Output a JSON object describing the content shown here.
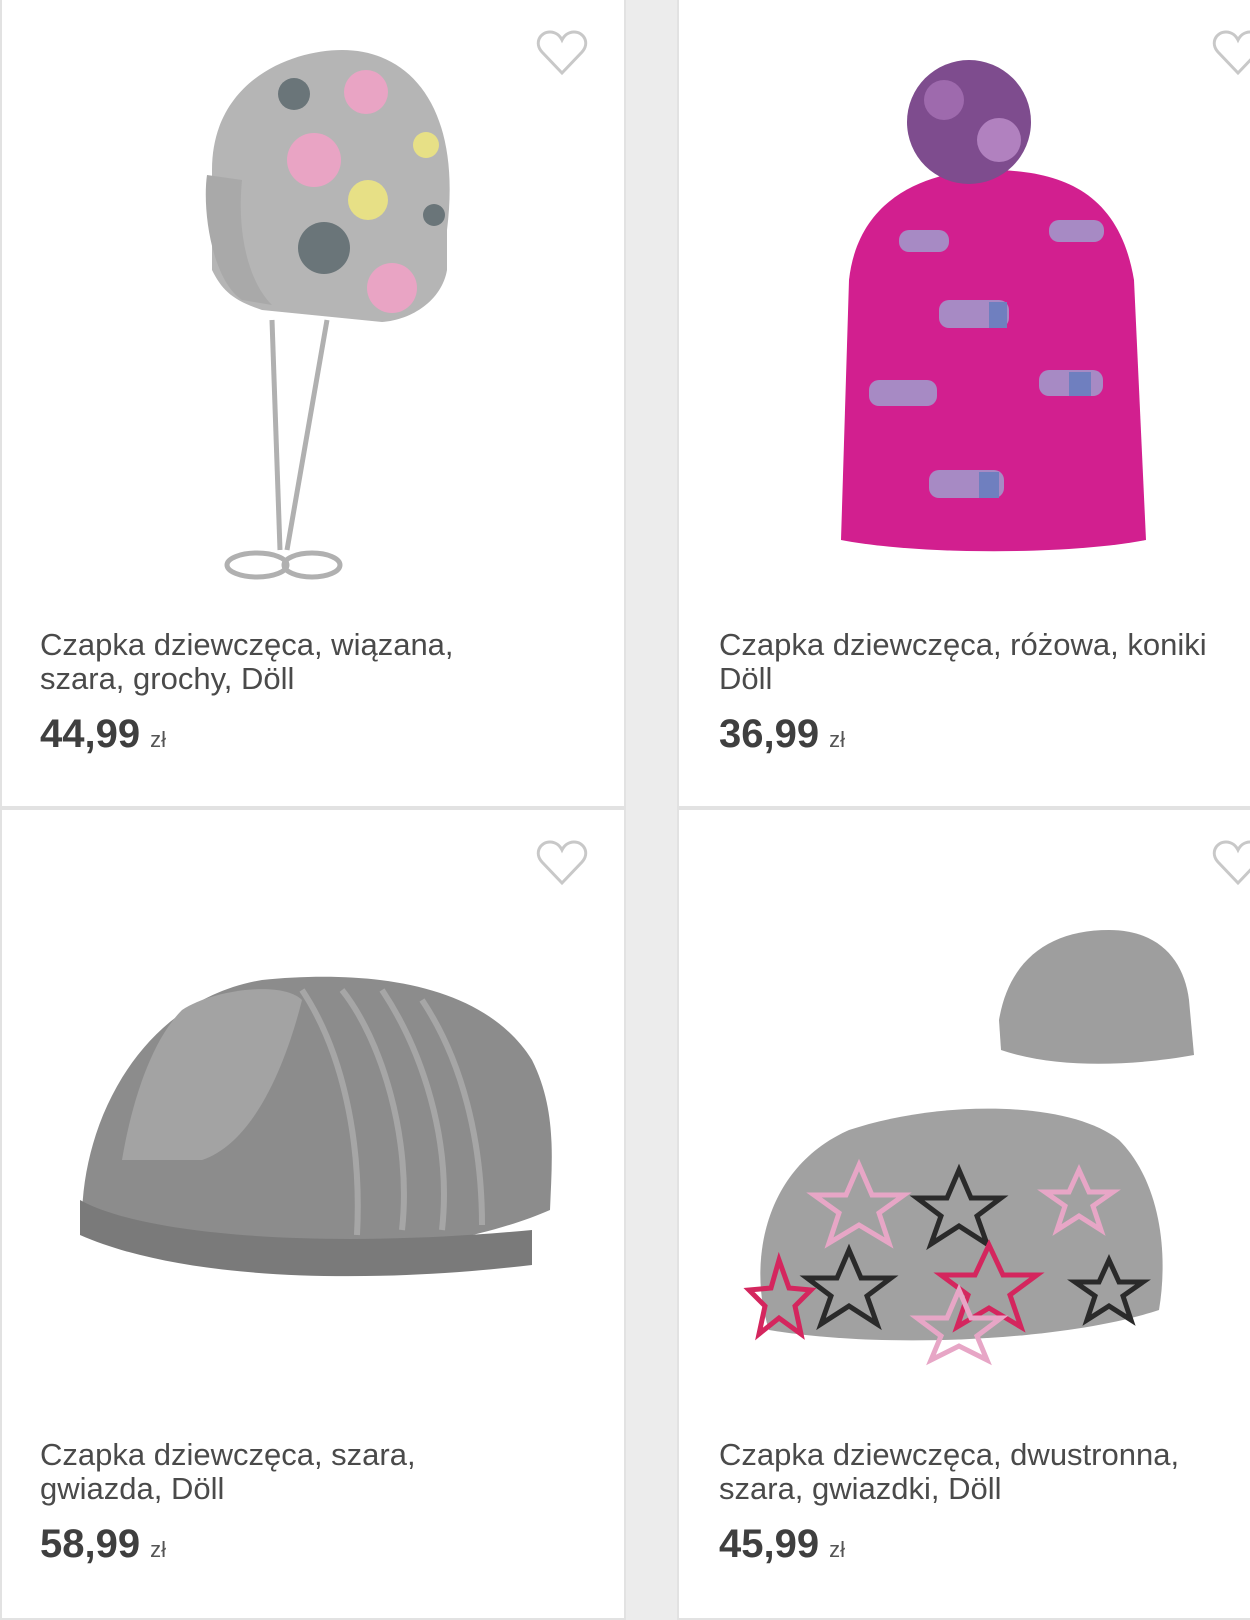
{
  "products": [
    {
      "title_line1": "Czapka dziewczęca, wiązana,",
      "title_line2": "szara, grochy, Döll",
      "price": "44,99",
      "currency": "zł",
      "image_icon": "grey-polka-dot-tie-hat-image",
      "favorite_icon": "heart-icon"
    },
    {
      "title_line1": "Czapka dziewczęca, różowa, koniki",
      "title_line2": "Döll",
      "price": "36,99",
      "currency": "zł",
      "image_icon": "pink-pony-pompom-hat-image",
      "favorite_icon": "heart-icon"
    },
    {
      "title_line1": "Czapka dziewczęca, szara,",
      "title_line2": "gwiazda, Döll",
      "price": "58,99",
      "currency": "zł",
      "image_icon": "grey-knit-star-beanie-image",
      "favorite_icon": "heart-icon"
    },
    {
      "title_line1": "Czapka dziewczęca, dwustronna,",
      "title_line2": "szara, gwiazdki, Döll",
      "price": "45,99",
      "currency": "zł",
      "image_icon": "reversible-grey-stars-beanie-image",
      "favorite_icon": "heart-icon"
    }
  ],
  "colors": {
    "background": "#ececec",
    "card": "#ffffff",
    "heart_outline": "#c8c8c8",
    "pink_hat": "#d21f8f"
  }
}
